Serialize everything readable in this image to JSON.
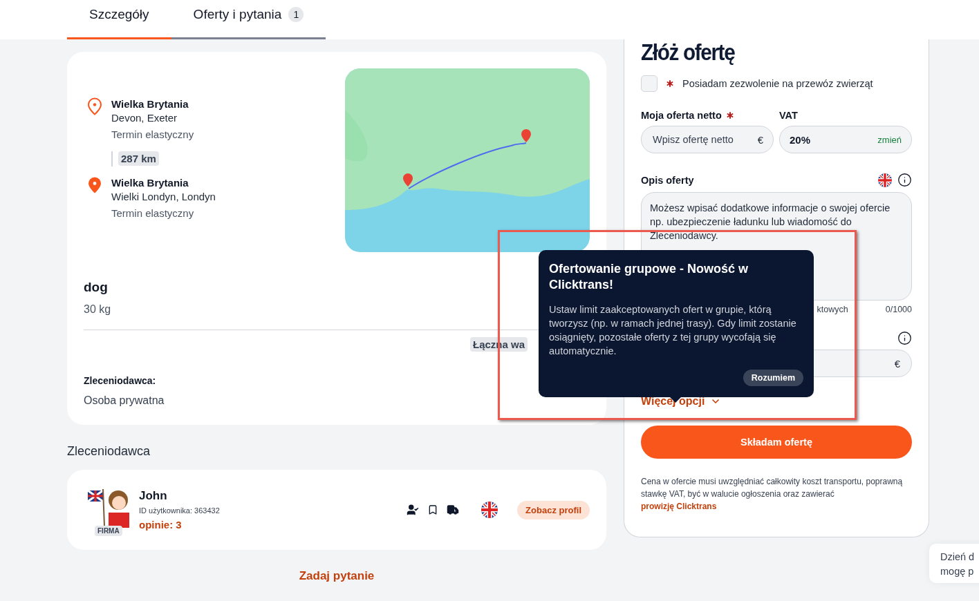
{
  "tabs": [
    {
      "label": "Szczegóły",
      "selected": true
    },
    {
      "label": "Oferty i pytania",
      "badge": "1",
      "selected": false
    }
  ],
  "route": {
    "stops": [
      {
        "kind": "origin",
        "country": "Wielka Brytania",
        "place": "Devon, Exeter",
        "date": "Termin elastyczny"
      },
      {
        "kind": "destination",
        "country": "Wielka Brytania",
        "place": "Wielki Londyn, Londyn",
        "date": "Termin elastyczny"
      }
    ],
    "distance": "287 km"
  },
  "cargo": {
    "name": "dog",
    "weight": "30 kg",
    "total_tag": "Łączna wa"
  },
  "client_type": {
    "label": "Zleceniodawca:",
    "value": "Osoba prywatna"
  },
  "client_section": {
    "heading": "Zleceniodawca",
    "name": "John",
    "user_id": "ID użytkownika: 363432",
    "reviews": "opinie: 3",
    "badge": "FIRMA",
    "profile_button": "Zobacz profil"
  },
  "ask_link": "Zadaj pytanie",
  "offer_form": {
    "title": "Złóż ofertę",
    "permit": {
      "label": "Posiadam zezwolenie na przewóz zwierząt",
      "checked": false
    },
    "net_label": "Moja oferta netto",
    "net_placeholder": "Wpisz ofertę netto",
    "currency": "€",
    "vat_label": "VAT",
    "vat_value": "20%",
    "vat_change": "zmień",
    "description_label": "Opis oferty",
    "description_placeholder": "Możesz wpisać dodatkowe informacje o swojej ofercie np. ubezpieczenie ładunku lub wiadomość do Zleceniodawcy.",
    "hint_fragment": "ktowych",
    "counter": "0/1000",
    "second_currency": "€",
    "more_options": "Więcej opcji",
    "submit": "Składam ofertę",
    "note": "Cena w ofercie musi uwzględniać całkowity koszt transportu, poprawną stawkę VAT, być w walucie ogłoszenia oraz zawierać",
    "note_link": "prowizję Clicktrans"
  },
  "tooltip": {
    "title": "Ofertowanie grupowe - Nowość w Clicktrans!",
    "body": "Ustaw limit zaakceptowanych ofert w grupie, którą tworzysz (np. w ramach jednej trasy). Gdy limit zostanie osiągnięty, pozostałe oferty z tej grupy wycofają się automatycznie.",
    "button": "Rozumiem"
  },
  "chat_bubble": {
    "lines": [
      "Dzień d",
      "mogę p"
    ]
  }
}
